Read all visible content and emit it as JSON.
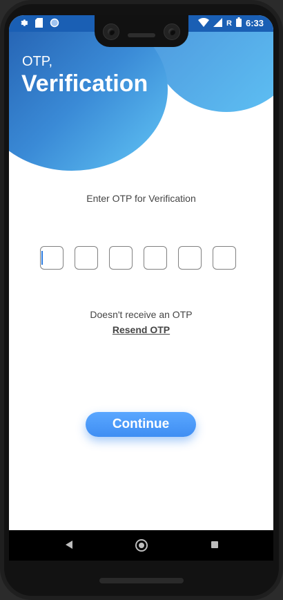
{
  "status_bar": {
    "time": "6:33",
    "signal_label": "R",
    "left_icons": [
      "gear-icon",
      "sd-card-icon",
      "circle-icon"
    ],
    "right_icons": [
      "wifi-icon",
      "signal-icon",
      "battery-icon"
    ]
  },
  "header": {
    "title_small": "OTP,",
    "title_big": "Verification"
  },
  "otp": {
    "prompt": "Enter OTP for Verification",
    "digits": [
      "",
      "",
      "",
      "",
      "",
      ""
    ]
  },
  "resend": {
    "question": "Doesn't receive an OTP",
    "link_label": "Resend OTP"
  },
  "actions": {
    "continue_label": "Continue"
  },
  "colors": {
    "accent": "#3f8ef3",
    "gradient_dark": "#1f57a8",
    "gradient_light": "#62c6f6"
  }
}
